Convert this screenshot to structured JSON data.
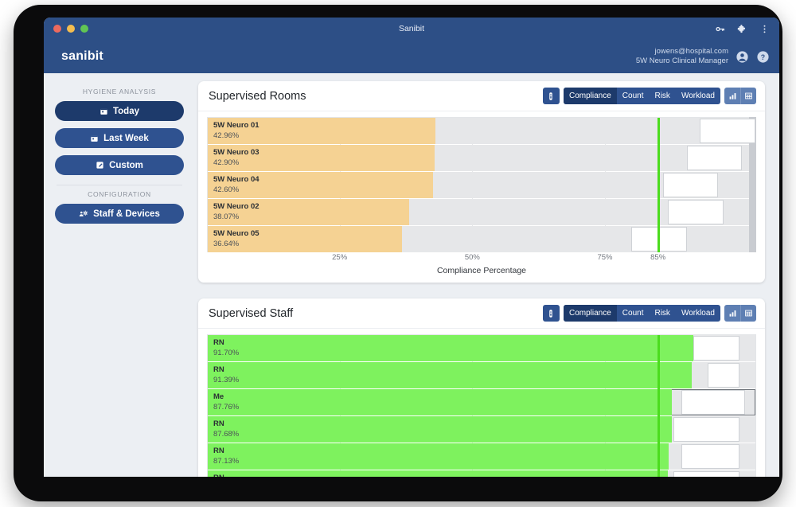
{
  "chrome": {
    "window_title": "Sanibit",
    "icons": [
      "key-icon",
      "extension-puzzle-icon",
      "kebab-menu-icon"
    ]
  },
  "header": {
    "brand": "sanibit",
    "user_email": "jowens@hospital.com",
    "user_role": "5W Neuro Clinical Manager",
    "account_icon": "account-circle-icon",
    "help_icon": "help-circle-icon"
  },
  "sidebar": {
    "sections": [
      {
        "caption": "HYGIENE ANALYSIS",
        "items": [
          {
            "label": "Today",
            "icon": "calendar-icon",
            "active": true
          },
          {
            "label": "Last Week",
            "icon": "calendar-icon",
            "active": false
          },
          {
            "label": "Custom",
            "icon": "edit-square-icon",
            "active": false
          }
        ]
      },
      {
        "caption": "CONFIGURATION",
        "items": [
          {
            "label": "Staff & Devices",
            "icon": "people-gear-icon",
            "active": false
          }
        ]
      }
    ]
  },
  "cards": [
    {
      "title": "Supervised Rooms",
      "dispenser_icon": "dispenser-icon",
      "metrics": [
        "Compliance",
        "Count",
        "Risk",
        "Workload"
      ],
      "active_metric": "Compliance",
      "view_icons": [
        "bar-chart-icon",
        "table-grid-icon"
      ],
      "active_view": "bar-chart-icon"
    },
    {
      "title": "Supervised Staff",
      "dispenser_icon": "dispenser-icon",
      "metrics": [
        "Compliance",
        "Count",
        "Risk",
        "Workload"
      ],
      "active_metric": "Compliance",
      "view_icons": [
        "bar-chart-icon",
        "table-grid-icon"
      ],
      "active_view": "bar-chart-icon"
    }
  ],
  "chart_data": [
    {
      "type": "bar",
      "title": "Supervised Rooms",
      "orientation": "horizontal",
      "xlabel": "Compliance Percentage",
      "ylabel": "",
      "xlim": [
        0,
        100
      ],
      "grid": true,
      "bar_color": "#f5d293",
      "track_color": "#e6e7e9",
      "target_value": 85,
      "target_label": "85%",
      "target_color": "#4cdc1e",
      "tick_values": [
        25,
        50,
        75,
        85
      ],
      "tick_labels": [
        "25%",
        "50%",
        "75%",
        "85%"
      ],
      "categories": [
        "5W Neuro 01",
        "5W Neuro 03",
        "5W Neuro 04",
        "5W Neuro 02",
        "5W Neuro 05"
      ],
      "values": [
        42.96,
        42.9,
        42.6,
        38.07,
        36.64
      ],
      "value_labels": [
        "42.96%",
        "42.90%",
        "42.60%",
        "38.07%",
        "36.64%"
      ],
      "overlay_boxes": [
        {
          "start": 93.0,
          "end": 103.5
        },
        {
          "start": 90.5,
          "end": 101.0
        },
        {
          "start": 86.0,
          "end": 96.5
        },
        {
          "start": 87.0,
          "end": 97.5
        },
        {
          "start": 80.0,
          "end": 90.5
        }
      ]
    },
    {
      "type": "bar",
      "title": "Supervised Staff",
      "orientation": "horizontal",
      "xlabel": "",
      "ylabel": "",
      "xlim": [
        0,
        100
      ],
      "grid": true,
      "bar_color": "#7ef25e",
      "track_color": "#e6e7e9",
      "target_value": 85,
      "target_color": "#4cdc1e",
      "categories": [
        "RN",
        "RN",
        "Me",
        "RN",
        "RN",
        "RN"
      ],
      "values": [
        91.7,
        91.39,
        87.76,
        87.68,
        87.13,
        86.9
      ],
      "value_labels": [
        "91.70%",
        "91.39%",
        "87.76%",
        "87.68%",
        "87.13%",
        ""
      ],
      "highlight_index": 2,
      "overlay_boxes": [
        {
          "start": 91.7,
          "end": 100.5
        },
        {
          "start": 94.5,
          "end": 100.5
        },
        {
          "start": 89.5,
          "end": 101.5
        },
        {
          "start": 88.0,
          "end": 100.5
        },
        {
          "start": 89.5,
          "end": 100.5
        },
        {
          "start": 88.0,
          "end": 100.5
        }
      ]
    }
  ]
}
